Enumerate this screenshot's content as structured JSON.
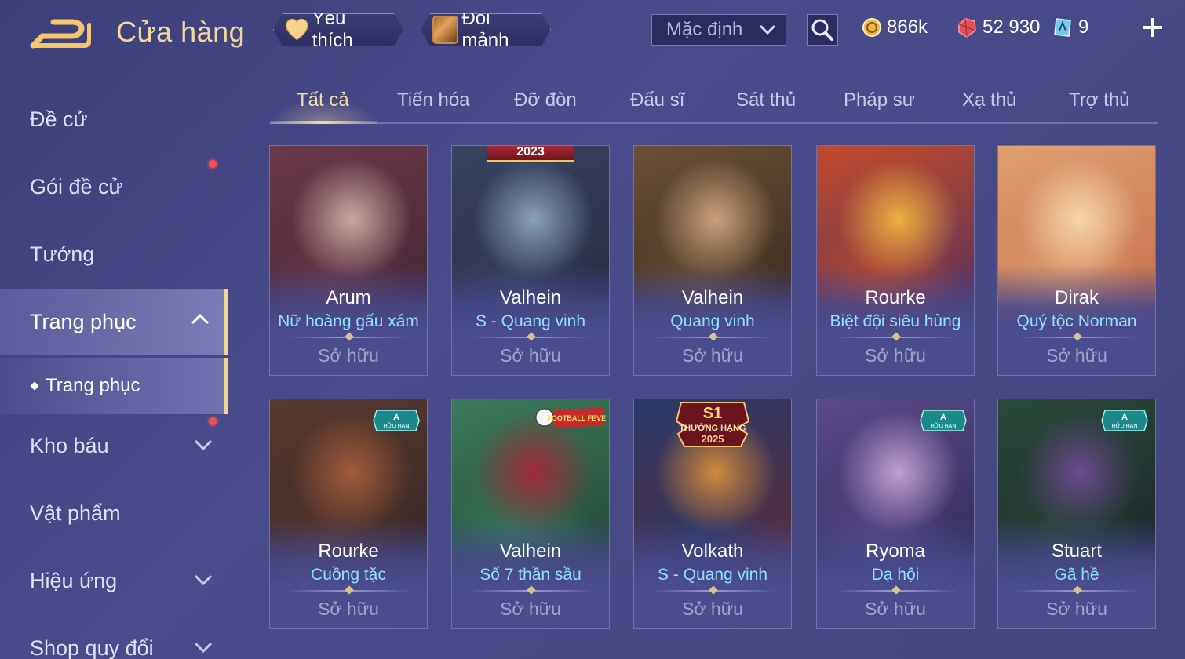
{
  "header": {
    "title": "Cửa hàng",
    "favorites_label": "Yêu thích",
    "exchange_label": "Đổi mảnh",
    "sort_value": "Mặc định",
    "gold": "866k",
    "gems": "52 930",
    "vouchers": "9"
  },
  "sidebar": {
    "items": [
      {
        "label": "Đề cử"
      },
      {
        "label": "Gói đề cử"
      },
      {
        "label": "Tướng"
      },
      {
        "label": "Trang phục"
      },
      {
        "label": "Kho báu"
      },
      {
        "label": "Vật phẩm"
      },
      {
        "label": "Hiệu ứng"
      },
      {
        "label": "Shop quy đổi"
      }
    ],
    "sub_item": "Trang phục"
  },
  "tabs": [
    "Tất cả",
    "Tiến hóa",
    "Đỡ đòn",
    "Đấu sĩ",
    "Sát thủ",
    "Pháp sư",
    "Xạ thủ",
    "Trợ thủ"
  ],
  "cards": [
    {
      "hero": "Arum",
      "skin": "Nữ hoàng gấu xám",
      "status": "Sở hữu",
      "palette": [
        "#6a3a4a",
        "#c9a9a0",
        "#3a2130"
      ]
    },
    {
      "hero": "Valhein",
      "skin": "S - Quang vinh",
      "status": "Sở hữu",
      "badge_text": "2023",
      "palette": [
        "#3a4360",
        "#8aa0b8",
        "#1f2438"
      ]
    },
    {
      "hero": "Valhein",
      "skin": "Quang vinh",
      "status": "Sở hữu",
      "palette": [
        "#6a5038",
        "#c9a27a",
        "#2c2218"
      ]
    },
    {
      "hero": "Rourke",
      "skin": "Biệt đội siêu hùng",
      "status": "Sở hữu",
      "palette": [
        "#c24a2a",
        "#f0b040",
        "#3a2a6a"
      ]
    },
    {
      "hero": "Dirak",
      "skin": "Quý tộc Norman",
      "status": "Sở hữu",
      "palette": [
        "#e0a070",
        "#f6d8a8",
        "#c06040"
      ]
    },
    {
      "hero": "Rourke",
      "skin": "Cuồng tặc",
      "status": "Sở hữu",
      "badge_a": "A",
      "badge_sub": "HỮU HẠN",
      "palette": [
        "#5a3a30",
        "#a05a3a",
        "#2a2024"
      ]
    },
    {
      "hero": "Valhein",
      "skin": "Số 7 thần sầu",
      "status": "Sở hữu",
      "badge_fever": "FOOTBALL FEVER",
      "palette": [
        "#3a7a5a",
        "#a02a3a",
        "#1e3a2e"
      ]
    },
    {
      "hero": "Volkath",
      "skin": "S - Quang vinh",
      "status": "Sở hữu",
      "badge_s1": "S1",
      "badge_s1_sub": "THƯỞNG HẠNG",
      "badge_s1_year": "2025",
      "palette": [
        "#2a3a6a",
        "#d08a3a",
        "#6a2a2a"
      ]
    },
    {
      "hero": "Ryoma",
      "skin": "Dạ hội",
      "status": "Sở hữu",
      "badge_a": "A",
      "badge_sub": "HỮU HẠN",
      "palette": [
        "#5a4a8a",
        "#c0a0d0",
        "#2a2448"
      ]
    },
    {
      "hero": "Stuart",
      "skin": "Gã hề",
      "status": "Sở hữu",
      "badge_a": "A",
      "badge_sub": "HỮU HẠN",
      "palette": [
        "#2a4a3a",
        "#6a4a8a",
        "#161a24"
      ]
    }
  ]
}
